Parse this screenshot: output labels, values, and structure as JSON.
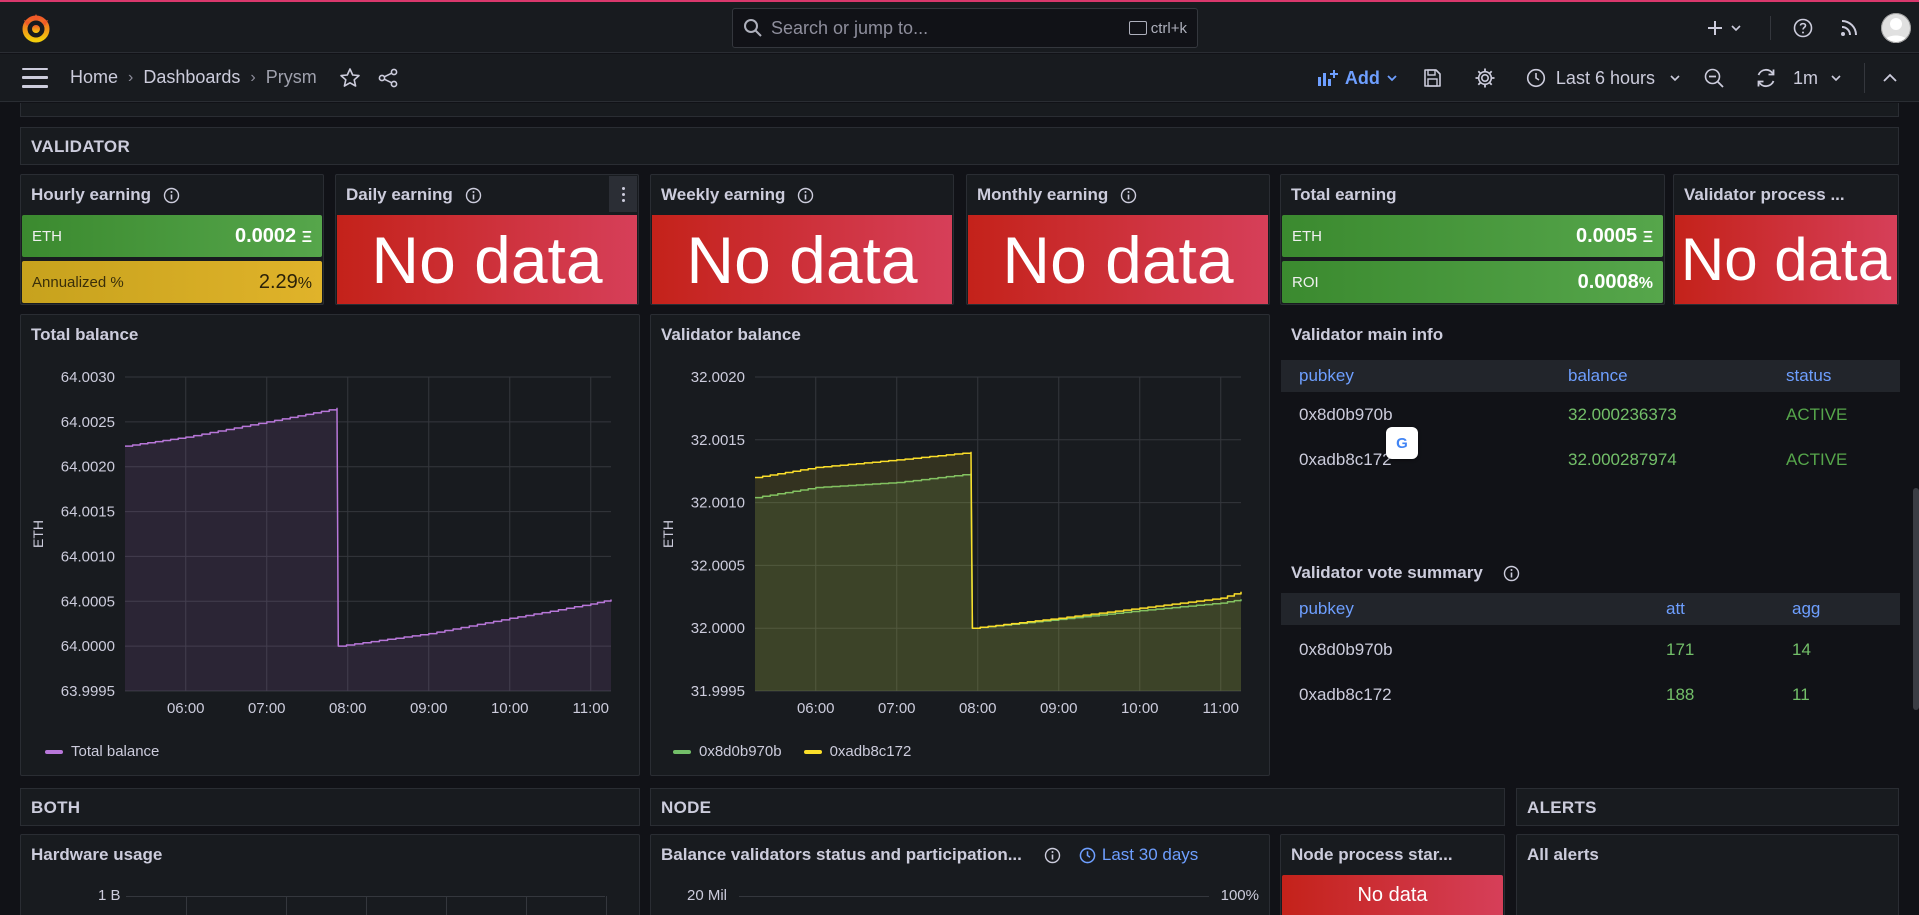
{
  "topbar": {
    "search_placeholder": "Search or jump to...",
    "search_shortcut": "ctrl+k"
  },
  "nav": {
    "breadcrumbs": [
      "Home",
      "Dashboards",
      "Prysm"
    ],
    "add_label": "Add",
    "time_range": "Last 6 hours",
    "refresh_interval": "1m"
  },
  "rows": {
    "validator": "VALIDATOR",
    "both": "BOTH",
    "node": "NODE",
    "alerts": "ALERTS"
  },
  "stats": {
    "hourly": {
      "title": "Hourly earning",
      "eth_label": "ETH",
      "eth_value": "0.0002",
      "eth_unit": "Ξ",
      "annual_label": "Annualized %",
      "annual_value": "2.29",
      "annual_unit": "%"
    },
    "daily": {
      "title": "Daily earning",
      "value": "No data"
    },
    "weekly": {
      "title": "Weekly earning",
      "value": "No data"
    },
    "monthly": {
      "title": "Monthly earning",
      "value": "No data"
    },
    "total": {
      "title": "Total earning",
      "eth_label": "ETH",
      "eth_value": "0.0005",
      "eth_unit": "Ξ",
      "roi_label": "ROI",
      "roi_value": "0.0008",
      "roi_unit": "%"
    },
    "process": {
      "title": "Validator process ...",
      "value": "No data"
    }
  },
  "colors": {
    "green": "#56a64b",
    "red": "#d63f59",
    "yellow": "#e0b32a",
    "purple": "#b877d9",
    "series_green": "#73bf69",
    "series_yellow": "#fade2a",
    "link_blue": "#6e9fff"
  },
  "main_info": {
    "title": "Validator main info",
    "columns": [
      "pubkey",
      "balance",
      "status"
    ],
    "rows": [
      [
        "0x8d0b970b",
        "32.000236373",
        "ACTIVE"
      ],
      [
        "0xadb8c172",
        "32.000287974",
        "ACTIVE"
      ]
    ]
  },
  "vote_summary": {
    "title": "Validator vote summary",
    "columns": [
      "pubkey",
      "att",
      "agg"
    ],
    "rows": [
      [
        "0x8d0b970b",
        "171",
        "14"
      ],
      [
        "0xadb8c172",
        "188",
        "11"
      ]
    ]
  },
  "bottom": {
    "hardware_title": "Hardware usage",
    "hardware_tick": "1 B",
    "balance_status_title": "Balance validators status and participation...",
    "balance_status_range": "Last 30 days",
    "balance_status_left_tick": "20 Mil",
    "balance_status_right_tick": "100%",
    "node_process_title": "Node process star...",
    "node_process_value": "No data",
    "alerts_title": "All alerts"
  },
  "chart_data": [
    {
      "type": "line",
      "title": "Total balance",
      "ylabel": "ETH",
      "xlabel": "",
      "ylim": [
        63.9995,
        64.003
      ],
      "yticks": [
        "64.0030",
        "64.0025",
        "64.0020",
        "64.0015",
        "64.0010",
        "64.0005",
        "64.0000",
        "63.9995"
      ],
      "xticks": [
        "06:00",
        "07:00",
        "08:00",
        "09:00",
        "10:00",
        "11:00"
      ],
      "xlim_hours": [
        5.25,
        11.25
      ],
      "fill": true,
      "legend_position": "bottom-left",
      "series": [
        {
          "name": "Total balance",
          "x": [
            "05:15",
            "06:00",
            "07:00",
            "07:52",
            "07:53",
            "09:00",
            "10:00",
            "11:00",
            "11:15"
          ],
          "values": [
            64.00223,
            64.00233,
            64.0025,
            64.00265,
            64.0,
            64.00014,
            64.00031,
            64.00047,
            64.00052
          ]
        }
      ]
    },
    {
      "type": "line",
      "title": "Validator balance",
      "ylabel": "ETH",
      "xlabel": "",
      "ylim": [
        31.9995,
        32.002
      ],
      "yticks": [
        "32.0020",
        "32.0015",
        "32.0010",
        "32.0005",
        "32.0000",
        "31.9995"
      ],
      "xticks": [
        "06:00",
        "07:00",
        "08:00",
        "09:00",
        "10:00",
        "11:00"
      ],
      "xlim_hours": [
        5.25,
        11.25
      ],
      "fill": true,
      "legend_position": "bottom-left",
      "series": [
        {
          "name": "0x8d0b970b",
          "x": [
            "05:15",
            "06:00",
            "07:00",
            "07:55",
            "07:56",
            "09:00",
            "10:00",
            "11:00",
            "11:15"
          ],
          "values": [
            32.00104,
            32.00112,
            32.00116,
            32.00123,
            32.0,
            32.00007,
            32.00014,
            32.0002,
            32.00023
          ]
        },
        {
          "name": "0xadb8c172",
          "x": [
            "05:15",
            "06:00",
            "07:00",
            "07:55",
            "07:56",
            "09:00",
            "10:00",
            "11:00",
            "11:15"
          ],
          "values": [
            32.0012,
            32.00128,
            32.00134,
            32.0014,
            32.0,
            32.00008,
            32.00016,
            32.00024,
            32.00029
          ]
        }
      ]
    }
  ]
}
